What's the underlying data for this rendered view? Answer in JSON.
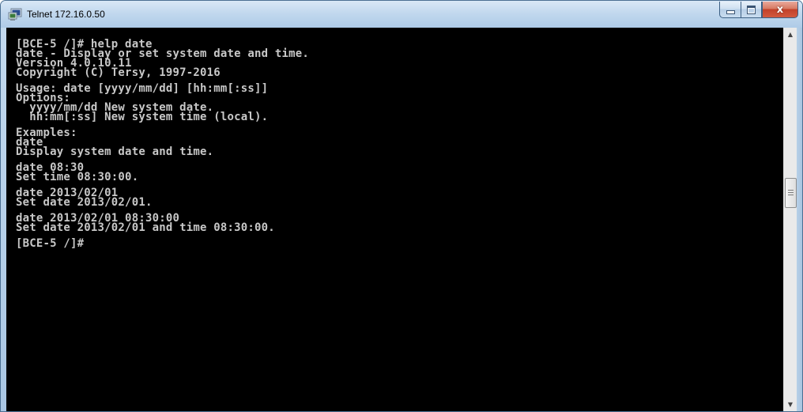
{
  "window": {
    "title": "Telnet 172.16.0.50",
    "app_icon": "telnet-terminal-icon",
    "close_glyph": "x"
  },
  "console": {
    "blocks": [
      [
        "[BCE-5 /]# help date",
        "date - Display or set system date and time.",
        "Version 4.0.10.11",
        "Copyright (C) Tersy, 1997-2016"
      ],
      [
        "Usage: date [yyyy/mm/dd] [hh:mm[:ss]]",
        "Options:",
        "  yyyy/mm/dd New system date.",
        "  hh:mm[:ss] New system time (local)."
      ],
      [
        "Examples:",
        "date",
        "Display system date and time."
      ],
      [
        "date 08:30",
        "Set time 08:30:00."
      ],
      [
        "date 2013/02/01",
        "Set date 2013/02/01."
      ],
      [
        "date 2013/02/01 08:30:00",
        "Set date 2013/02/01 and time 08:30:00."
      ],
      [
        "[BCE-5 /]#"
      ]
    ]
  },
  "scrollbar": {
    "up_icon": "▲",
    "down_icon": "▼",
    "position": 0.42
  }
}
